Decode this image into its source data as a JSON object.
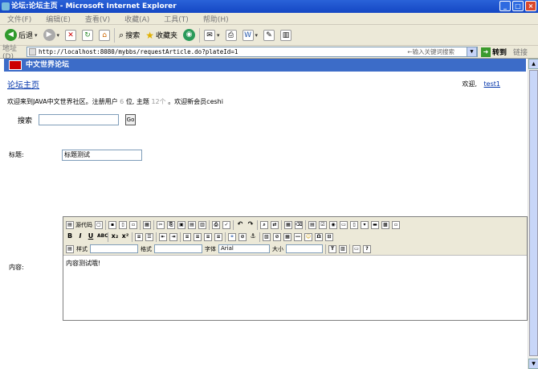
{
  "window": {
    "title": "论坛:论坛主页 - Microsoft Internet Explorer",
    "buttons": [
      "_",
      "□",
      "×"
    ]
  },
  "menu": [
    "文件(F)",
    "编辑(E)",
    "查看(V)",
    "收藏(A)",
    "工具(T)",
    "帮助(H)"
  ],
  "toolbar": {
    "back": "后退",
    "search": "搜索",
    "favorites": "收藏夹"
  },
  "address": {
    "label": "地址(D)",
    "url": "http://localhost:8080/mybbs/requestArticle.do?plateId=1",
    "hint": "←输入关键词搜索",
    "go": "转到",
    "links": "链接"
  },
  "banner": {
    "title": "中文世界论坛"
  },
  "page": {
    "forum_home": "论坛主页",
    "welcome_prefix": "欢迎,",
    "username": "test1",
    "stats": {
      "t1": "欢迎来到JAVA中文世界社区。注册用户",
      "users": "6",
      "t2": "位, 主题",
      "topics": "12个",
      "t3": "。欢迎新会员ceshi"
    },
    "search_label": "搜索",
    "search_value": "",
    "search_go": "Go",
    "title_label": "标题:",
    "title_value": "标题测试",
    "content_label": "内容:"
  },
  "editor": {
    "source": "源代码",
    "style_label": "样式",
    "format_label": "格式",
    "font_label": "字体",
    "size_label": "大小",
    "font_value": "Arial",
    "content": "内容测试哦!"
  }
}
